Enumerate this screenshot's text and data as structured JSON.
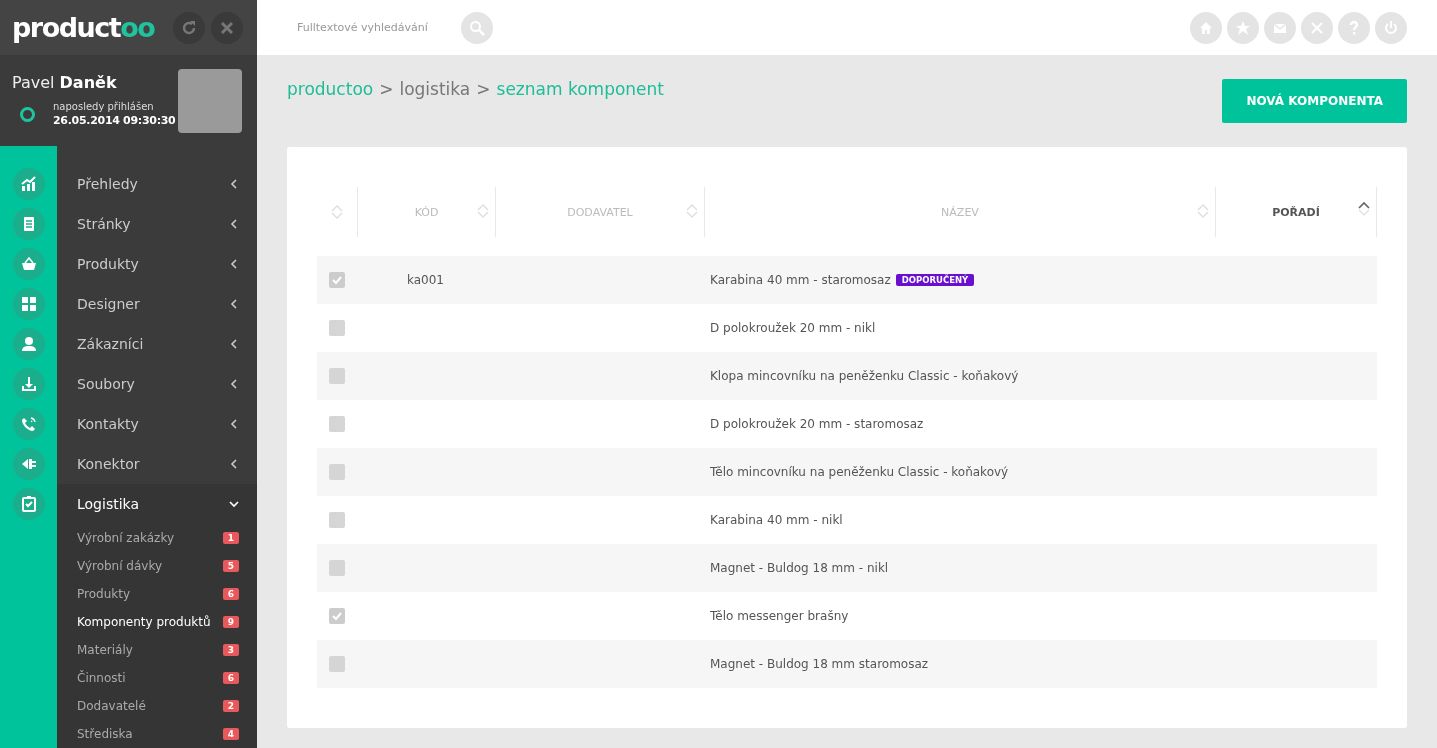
{
  "sidebar": {
    "logo": {
      "text": "product",
      "accent": "oo"
    },
    "user": {
      "first_name": "Pavel",
      "last_name": "Daněk",
      "last_login_label": "naposledy přihlášen",
      "last_login": "26.05.2014 09:30:30",
      "online": true
    },
    "nav": [
      {
        "label": "Přehledy",
        "expanded": false
      },
      {
        "label": "Stránky",
        "expanded": false
      },
      {
        "label": "Produkty",
        "expanded": false
      },
      {
        "label": "Designer",
        "expanded": false
      },
      {
        "label": "Zákazníci",
        "expanded": false
      },
      {
        "label": "Soubory",
        "expanded": false
      },
      {
        "label": "Kontakty",
        "expanded": false
      },
      {
        "label": "Konektor",
        "expanded": false
      },
      {
        "label": "Logistika",
        "expanded": true,
        "children": [
          {
            "label": "Výrobní zakázky",
            "count": "1",
            "selected": false
          },
          {
            "label": "Výrobní dávky",
            "count": "5",
            "selected": false
          },
          {
            "label": "Produkty",
            "count": "6",
            "selected": false
          },
          {
            "label": "Komponenty produktů",
            "count": "9",
            "selected": true
          },
          {
            "label": "Materiály",
            "count": "3",
            "selected": false
          },
          {
            "label": "Činnosti",
            "count": "6",
            "selected": false
          },
          {
            "label": "Dodavatelé",
            "count": "2",
            "selected": false
          },
          {
            "label": "Střediska",
            "count": "4",
            "selected": false
          }
        ]
      }
    ]
  },
  "topbar": {
    "search": {
      "placeholder": "Fulltextové vyhledávání"
    }
  },
  "breadcrumb": [
    {
      "label": "productoo",
      "link": true
    },
    {
      "label": "logistika",
      "link": false
    },
    {
      "label": "seznam komponent",
      "link": true
    }
  ],
  "breadcrumb_separator": ">",
  "new_button": "NOVÁ KOMPONENTA",
  "table": {
    "columns": [
      {
        "sorted": false
      },
      {
        "label": "KÓD",
        "sorted": false
      },
      {
        "label": "DODAVATEL",
        "sorted": false
      },
      {
        "label": "NÁZEV",
        "sorted": false
      },
      {
        "label": "POŘADÍ",
        "sorted": true
      }
    ],
    "rows": [
      {
        "checked": true,
        "code": "ka001",
        "name": "Karabina 40 mm - staromosaz",
        "badge": "DOPORUČENÝ"
      },
      {
        "checked": false,
        "name": "D polokroužek 20 mm - nikl"
      },
      {
        "checked": false,
        "name": "Klopa mincovníku na peněženku Classic - koňakový"
      },
      {
        "checked": false,
        "name": "D polokroužek 20 mm - staromosaz"
      },
      {
        "checked": false,
        "name": "Tělo mincovníku na peněženku Classic - koňakový"
      },
      {
        "checked": false,
        "name": "Karabina 40 mm - nikl"
      },
      {
        "checked": false,
        "name": "Magnet - Buldog 18 mm - nikl"
      },
      {
        "checked": true,
        "name": "Tělo messenger brašny"
      },
      {
        "checked": false,
        "name": "Magnet - Buldog 18 mm staromosaz"
      }
    ]
  }
}
